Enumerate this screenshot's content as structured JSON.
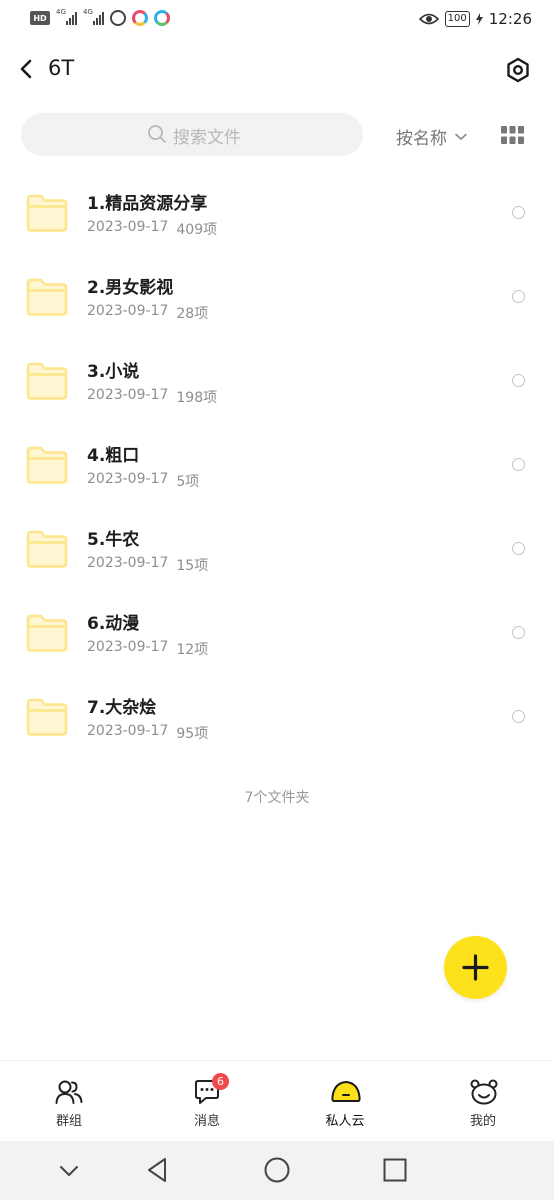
{
  "status_bar": {
    "hd_label": "HD",
    "network_1": "4G",
    "network_2": "4G",
    "battery": "100",
    "time": "12:26"
  },
  "header": {
    "title": "6T",
    "back_icon": "chevron-left-icon",
    "settings_icon": "hexagon-settings-icon"
  },
  "search": {
    "placeholder": "搜索文件"
  },
  "sort": {
    "label": "按名称"
  },
  "files": [
    {
      "name": "1.精品资源分享",
      "date": "2023-09-17",
      "count": "409项"
    },
    {
      "name": "2.男女影视",
      "date": "2023-09-17",
      "count": "28项"
    },
    {
      "name": "3.小说",
      "date": "2023-09-17",
      "count": "198项"
    },
    {
      "name": "4.粗口",
      "date": "2023-09-17",
      "count": "5项"
    },
    {
      "name": "5.牛农",
      "date": "2023-09-17",
      "count": "15项"
    },
    {
      "name": "6.动漫",
      "date": "2023-09-17",
      "count": "12项"
    },
    {
      "name": "7.大杂烩",
      "date": "2023-09-17",
      "count": "95项"
    }
  ],
  "folder_count": "7个文件夹",
  "bottom_nav": [
    {
      "label": "群组",
      "icon": "group-icon"
    },
    {
      "label": "消息",
      "icon": "message-icon",
      "badge": "6"
    },
    {
      "label": "私人云",
      "icon": "cloud-face-icon",
      "active": true
    },
    {
      "label": "我的",
      "icon": "bear-face-icon"
    }
  ],
  "colors": {
    "accent": "#fde21b",
    "folder": "#fde58a",
    "badge": "#f04b4b"
  }
}
